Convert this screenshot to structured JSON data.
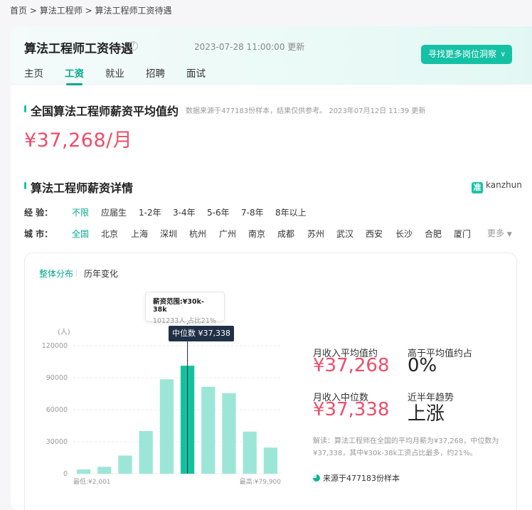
{
  "breadcrumb": [
    "首页",
    "算法工程师",
    "算法工程师工资待遇"
  ],
  "header": {
    "title": "算法工程师工资待遇",
    "help": "?",
    "updated": "2023-07-28 11:00:00 更新",
    "cta_label": "寻找更多岗位洞察"
  },
  "tabs": [
    "主页",
    "工资",
    "就业",
    "招聘",
    "面试"
  ],
  "active_tab": "工资",
  "avg_section": {
    "title": "全国算法工程师薪资平均值约",
    "note": "数据来源于477183份样本，结果仅供参考。  2023年07月12日 11:39 更新",
    "salary": "¥37,268/月"
  },
  "detail_section": {
    "title": "算法工程师薪资详情",
    "brand": "kanzhun",
    "brand_logo": "准"
  },
  "filters": {
    "experience": {
      "label": "经 验：",
      "options": [
        "不限",
        "应届生",
        "1-2年",
        "3-4年",
        "5-6年",
        "7-8年",
        "8年以上"
      ],
      "selected": "不限"
    },
    "city": {
      "label": "城 市：",
      "options": [
        "全国",
        "北京",
        "上海",
        "深圳",
        "杭州",
        "广州",
        "南京",
        "成都",
        "苏州",
        "武汉",
        "西安",
        "长沙",
        "合肥",
        "厦门"
      ],
      "selected": "全国",
      "more": "更多"
    }
  },
  "subtabs": [
    "整体分布",
    "历年变化"
  ],
  "active_subtab": "整体分布",
  "tooltip": {
    "line1": "薪资范围:¥30k-38k",
    "line2": "101233人  占比21%"
  },
  "median_tag": "中位数 ¥37,338",
  "chart_data": {
    "type": "bar",
    "ylabel": "(人)",
    "yticks": [
      0,
      30000,
      60000,
      90000,
      120000
    ],
    "ylim": [
      0,
      120000
    ],
    "xmin_label": "最低:¥2,001",
    "xmax_label": "最高:¥79,900",
    "values": [
      4000,
      6500,
      17000,
      40000,
      88500,
      101233,
      81500,
      75500,
      39500,
      24500
    ],
    "highlight_index": 5,
    "median_position": 5.5,
    "colors": {
      "bar": "#9ce6d8",
      "highlight": "#12c29e"
    }
  },
  "stats": {
    "avg_label": "月收入平均值约",
    "avg_value": "¥37,268",
    "above_label": "高于平均值约占",
    "above_value": "0%",
    "median_label": "月收入中位数",
    "median_value": "¥37,338",
    "trend_label": "近半年趋势",
    "trend_value": "上涨"
  },
  "description": "解读：算法工程师在全国的平均月薪为¥37,268，中位数为¥37,338，其中¥30k-38k工资占比最多，约21%。",
  "source": "来源于477183份样本"
}
